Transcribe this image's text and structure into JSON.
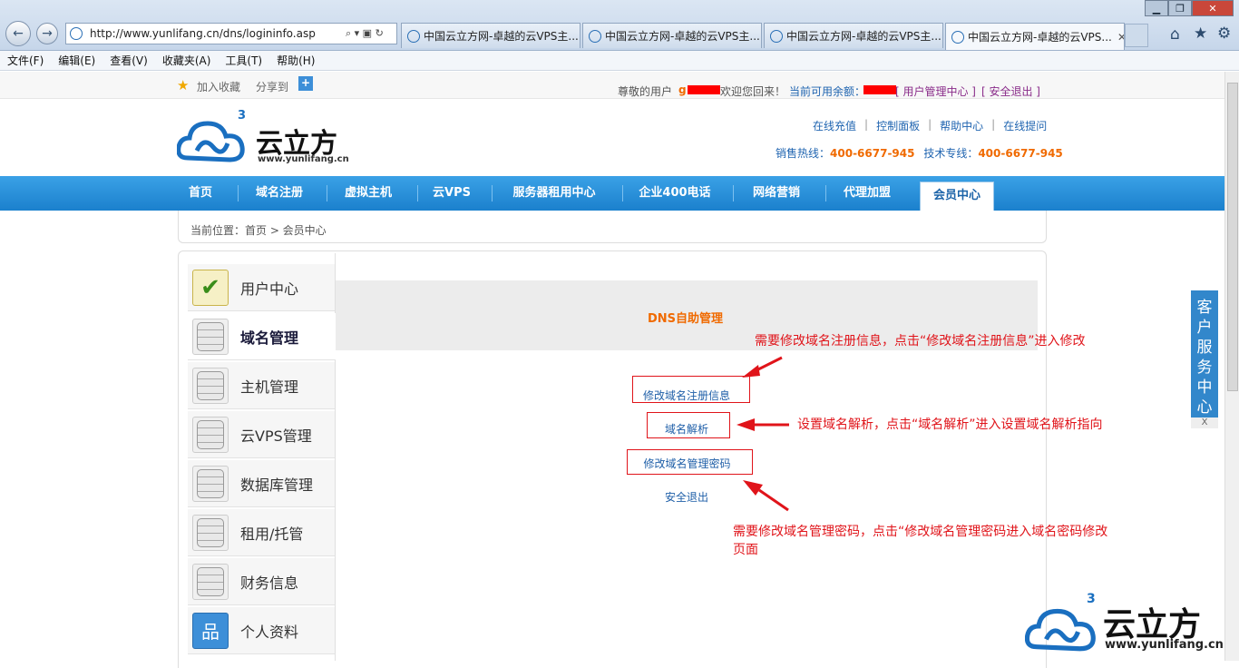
{
  "browser": {
    "url": "http://www.yunlifang.cn/dns/logininfo.asp",
    "tabs": [
      {
        "label": "中国云立方网-卓越的云VPS主..."
      },
      {
        "label": "中国云立方网-卓越的云VPS主..."
      },
      {
        "label": "中国云立方网-卓越的云VPS主..."
      },
      {
        "label": "中国云立方网-卓越的云VPS..."
      }
    ],
    "tab_close": "✕",
    "menu": [
      "文件(F)",
      "编辑(E)",
      "查看(V)",
      "收藏夹(A)",
      "工具(T)",
      "帮助(H)"
    ]
  },
  "topbar": {
    "favorite": "加入收藏",
    "share": "分享到",
    "greeting_prefix": "尊敬的用户",
    "user_partial": "g",
    "welcome": "欢迎您回来！",
    "balance_label": "当前可用余额：",
    "user_center": "[ 用户管理中心 ]",
    "logout": "[ 安全退出 ]"
  },
  "header": {
    "logo_text": "云立方",
    "logo_url": "www.yunlifang.cn",
    "logo_sup": "3",
    "links": [
      "在线充值",
      "控制面板",
      "帮助中心",
      "在线提问"
    ],
    "sales_label": "销售热线：",
    "sales_phone": "400-6677-945",
    "tech_label": "技术专线：",
    "tech_phone": "400-6677-945"
  },
  "nav": {
    "items": [
      "首页",
      "域名注册",
      "虚拟主机",
      "云VPS",
      "服务器租用中心",
      "企业400电话",
      "网络营销",
      "代理加盟"
    ],
    "active": "会员中心"
  },
  "breadcrumb": "当前位置：首页 > 会员中心",
  "sidebar": {
    "items": [
      {
        "label": "用户中心",
        "icon": "check-icon"
      },
      {
        "label": "域名管理",
        "icon": "database-icon"
      },
      {
        "label": "主机管理",
        "icon": "database-icon"
      },
      {
        "label": "云VPS管理",
        "icon": "database-icon"
      },
      {
        "label": "数据库管理",
        "icon": "database-icon"
      },
      {
        "label": "租用/托管",
        "icon": "database-icon"
      },
      {
        "label": "财务信息",
        "icon": "database-icon"
      },
      {
        "label": "个人资料",
        "icon": "org-chart-icon"
      }
    ]
  },
  "dns": {
    "title": "DNS自助管理",
    "modify_reg": "修改域名注册信息",
    "resolve": "域名解析",
    "modify_pwd": "修改域名管理密码",
    "logout": "安全退出"
  },
  "annotations": {
    "a1": "需要修改域名注册信息，点击“修改域名注册信息”进入修改",
    "a2": "设置域名解析，点击“域名解析”进入设置域名解析指向",
    "a3_line1": "需要修改域名管理密码，点击“修改域名管理密码进入域名密码修改",
    "a3_line2": "页面"
  },
  "customer_service": {
    "label": "客户服务中心",
    "close": "X"
  },
  "colors": {
    "nav_blue": "#1b80cd",
    "orange": "#f06a00",
    "red": "#e0141a",
    "link_blue": "#1f5fa8"
  }
}
